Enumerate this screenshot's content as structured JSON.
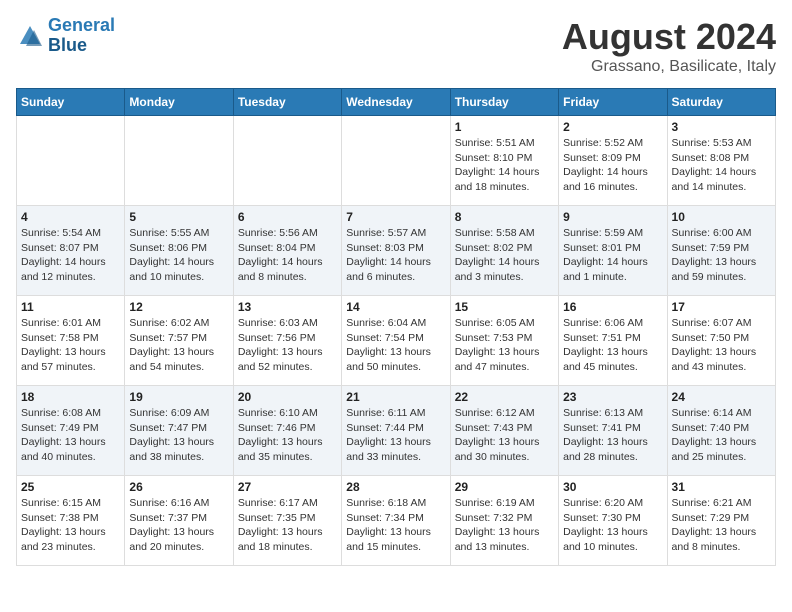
{
  "header": {
    "logo_line1": "General",
    "logo_line2": "Blue",
    "main_title": "August 2024",
    "subtitle": "Grassano, Basilicate, Italy"
  },
  "days_of_week": [
    "Sunday",
    "Monday",
    "Tuesday",
    "Wednesday",
    "Thursday",
    "Friday",
    "Saturday"
  ],
  "weeks": [
    [
      {
        "num": "",
        "info": ""
      },
      {
        "num": "",
        "info": ""
      },
      {
        "num": "",
        "info": ""
      },
      {
        "num": "",
        "info": ""
      },
      {
        "num": "1",
        "info": "Sunrise: 5:51 AM\nSunset: 8:10 PM\nDaylight: 14 hours\nand 18 minutes."
      },
      {
        "num": "2",
        "info": "Sunrise: 5:52 AM\nSunset: 8:09 PM\nDaylight: 14 hours\nand 16 minutes."
      },
      {
        "num": "3",
        "info": "Sunrise: 5:53 AM\nSunset: 8:08 PM\nDaylight: 14 hours\nand 14 minutes."
      }
    ],
    [
      {
        "num": "4",
        "info": "Sunrise: 5:54 AM\nSunset: 8:07 PM\nDaylight: 14 hours\nand 12 minutes."
      },
      {
        "num": "5",
        "info": "Sunrise: 5:55 AM\nSunset: 8:06 PM\nDaylight: 14 hours\nand 10 minutes."
      },
      {
        "num": "6",
        "info": "Sunrise: 5:56 AM\nSunset: 8:04 PM\nDaylight: 14 hours\nand 8 minutes."
      },
      {
        "num": "7",
        "info": "Sunrise: 5:57 AM\nSunset: 8:03 PM\nDaylight: 14 hours\nand 6 minutes."
      },
      {
        "num": "8",
        "info": "Sunrise: 5:58 AM\nSunset: 8:02 PM\nDaylight: 14 hours\nand 3 minutes."
      },
      {
        "num": "9",
        "info": "Sunrise: 5:59 AM\nSunset: 8:01 PM\nDaylight: 14 hours\nand 1 minute."
      },
      {
        "num": "10",
        "info": "Sunrise: 6:00 AM\nSunset: 7:59 PM\nDaylight: 13 hours\nand 59 minutes."
      }
    ],
    [
      {
        "num": "11",
        "info": "Sunrise: 6:01 AM\nSunset: 7:58 PM\nDaylight: 13 hours\nand 57 minutes."
      },
      {
        "num": "12",
        "info": "Sunrise: 6:02 AM\nSunset: 7:57 PM\nDaylight: 13 hours\nand 54 minutes."
      },
      {
        "num": "13",
        "info": "Sunrise: 6:03 AM\nSunset: 7:56 PM\nDaylight: 13 hours\nand 52 minutes."
      },
      {
        "num": "14",
        "info": "Sunrise: 6:04 AM\nSunset: 7:54 PM\nDaylight: 13 hours\nand 50 minutes."
      },
      {
        "num": "15",
        "info": "Sunrise: 6:05 AM\nSunset: 7:53 PM\nDaylight: 13 hours\nand 47 minutes."
      },
      {
        "num": "16",
        "info": "Sunrise: 6:06 AM\nSunset: 7:51 PM\nDaylight: 13 hours\nand 45 minutes."
      },
      {
        "num": "17",
        "info": "Sunrise: 6:07 AM\nSunset: 7:50 PM\nDaylight: 13 hours\nand 43 minutes."
      }
    ],
    [
      {
        "num": "18",
        "info": "Sunrise: 6:08 AM\nSunset: 7:49 PM\nDaylight: 13 hours\nand 40 minutes."
      },
      {
        "num": "19",
        "info": "Sunrise: 6:09 AM\nSunset: 7:47 PM\nDaylight: 13 hours\nand 38 minutes."
      },
      {
        "num": "20",
        "info": "Sunrise: 6:10 AM\nSunset: 7:46 PM\nDaylight: 13 hours\nand 35 minutes."
      },
      {
        "num": "21",
        "info": "Sunrise: 6:11 AM\nSunset: 7:44 PM\nDaylight: 13 hours\nand 33 minutes."
      },
      {
        "num": "22",
        "info": "Sunrise: 6:12 AM\nSunset: 7:43 PM\nDaylight: 13 hours\nand 30 minutes."
      },
      {
        "num": "23",
        "info": "Sunrise: 6:13 AM\nSunset: 7:41 PM\nDaylight: 13 hours\nand 28 minutes."
      },
      {
        "num": "24",
        "info": "Sunrise: 6:14 AM\nSunset: 7:40 PM\nDaylight: 13 hours\nand 25 minutes."
      }
    ],
    [
      {
        "num": "25",
        "info": "Sunrise: 6:15 AM\nSunset: 7:38 PM\nDaylight: 13 hours\nand 23 minutes."
      },
      {
        "num": "26",
        "info": "Sunrise: 6:16 AM\nSunset: 7:37 PM\nDaylight: 13 hours\nand 20 minutes."
      },
      {
        "num": "27",
        "info": "Sunrise: 6:17 AM\nSunset: 7:35 PM\nDaylight: 13 hours\nand 18 minutes."
      },
      {
        "num": "28",
        "info": "Sunrise: 6:18 AM\nSunset: 7:34 PM\nDaylight: 13 hours\nand 15 minutes."
      },
      {
        "num": "29",
        "info": "Sunrise: 6:19 AM\nSunset: 7:32 PM\nDaylight: 13 hours\nand 13 minutes."
      },
      {
        "num": "30",
        "info": "Sunrise: 6:20 AM\nSunset: 7:30 PM\nDaylight: 13 hours\nand 10 minutes."
      },
      {
        "num": "31",
        "info": "Sunrise: 6:21 AM\nSunset: 7:29 PM\nDaylight: 13 hours\nand 8 minutes."
      }
    ]
  ]
}
